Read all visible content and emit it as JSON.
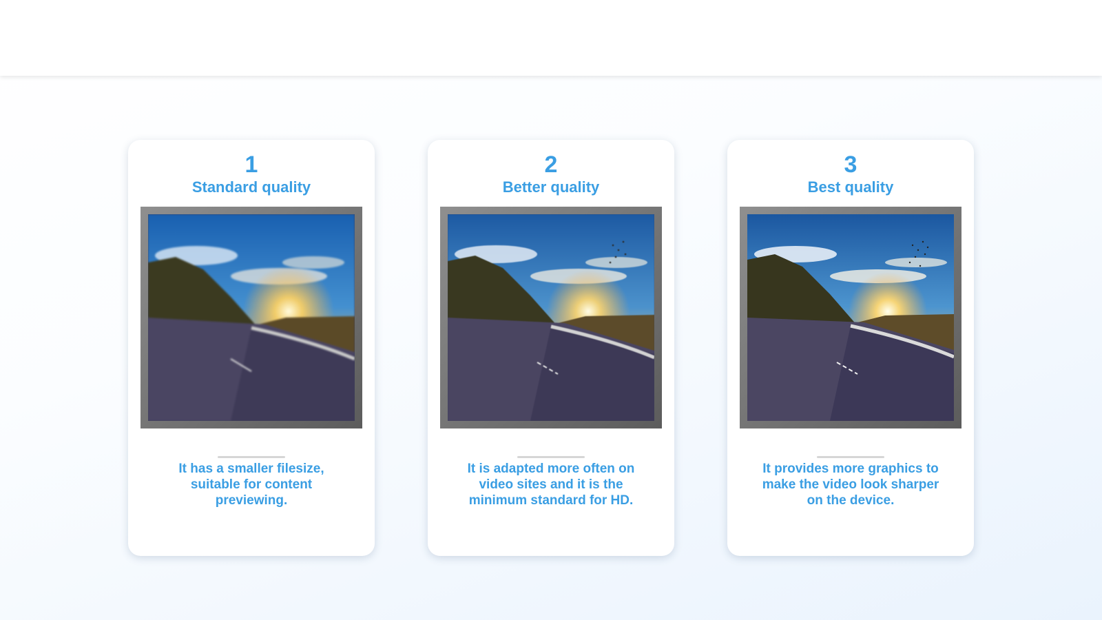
{
  "cards": [
    {
      "number": "1",
      "title": "Standard quality",
      "description": "It has a smaller filesize, suitable for content previewing.",
      "image": "road-sunset-photo-low-resolution"
    },
    {
      "number": "2",
      "title": "Better quality",
      "description": "It is adapted more often on video sites and it is the minimum standard for HD.",
      "image": "road-sunset-photo-medium-resolution"
    },
    {
      "number": "3",
      "title": "Best quality",
      "description": "It provides more graphics to make the video look sharper on the device.",
      "image": "road-sunset-photo-high-resolution"
    }
  ],
  "colors": {
    "accent": "#3a9ee3",
    "frame": "#777777",
    "divider": "#d6d6d6"
  }
}
